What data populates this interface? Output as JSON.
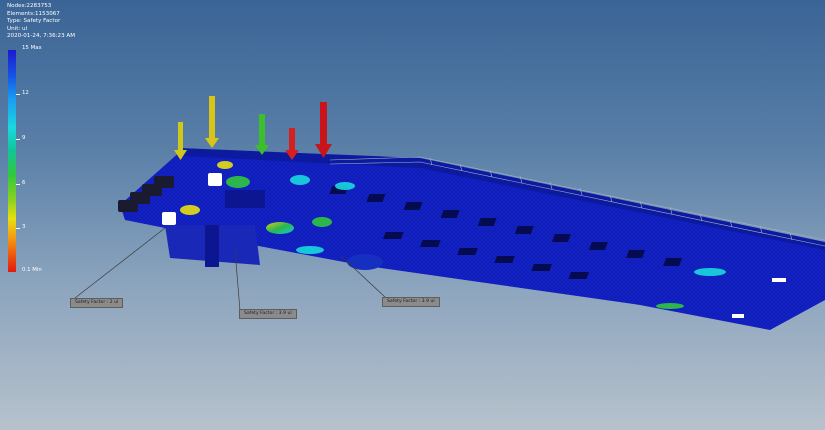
{
  "info": {
    "nodes": "Nodes:2283753",
    "elements": "Elements:1153067",
    "type": "Type: Safety Factor",
    "unit": "Unit: ul",
    "timestamp": "2020-01-24, 7:36:23 AM"
  },
  "legend": {
    "max_label": "15 Max",
    "min_label": "0.1 Min",
    "ticks": [
      "12",
      "9",
      "6",
      "3"
    ],
    "colors": [
      "#1a1ad0",
      "#1a9cf0",
      "#13c49a",
      "#2fc840",
      "#e8e010",
      "#f05a10",
      "#e01a10"
    ]
  },
  "probes": [
    {
      "label": "Safety Factor : 2 ul"
    },
    {
      "label": "Safety Factor : 3.9 ul"
    },
    {
      "label": "Safety Factor : 3.9 ul"
    }
  ],
  "load_arrows": {
    "colors": [
      "#cfc71c",
      "#d9c51a",
      "#3bbf2a",
      "#d62020",
      "#c8141a"
    ],
    "icon": "force-arrow-icon"
  },
  "colors": {
    "background_top": "#3a6496",
    "background_bottom": "#b7c2cc",
    "model_blue": "#1020c8"
  }
}
